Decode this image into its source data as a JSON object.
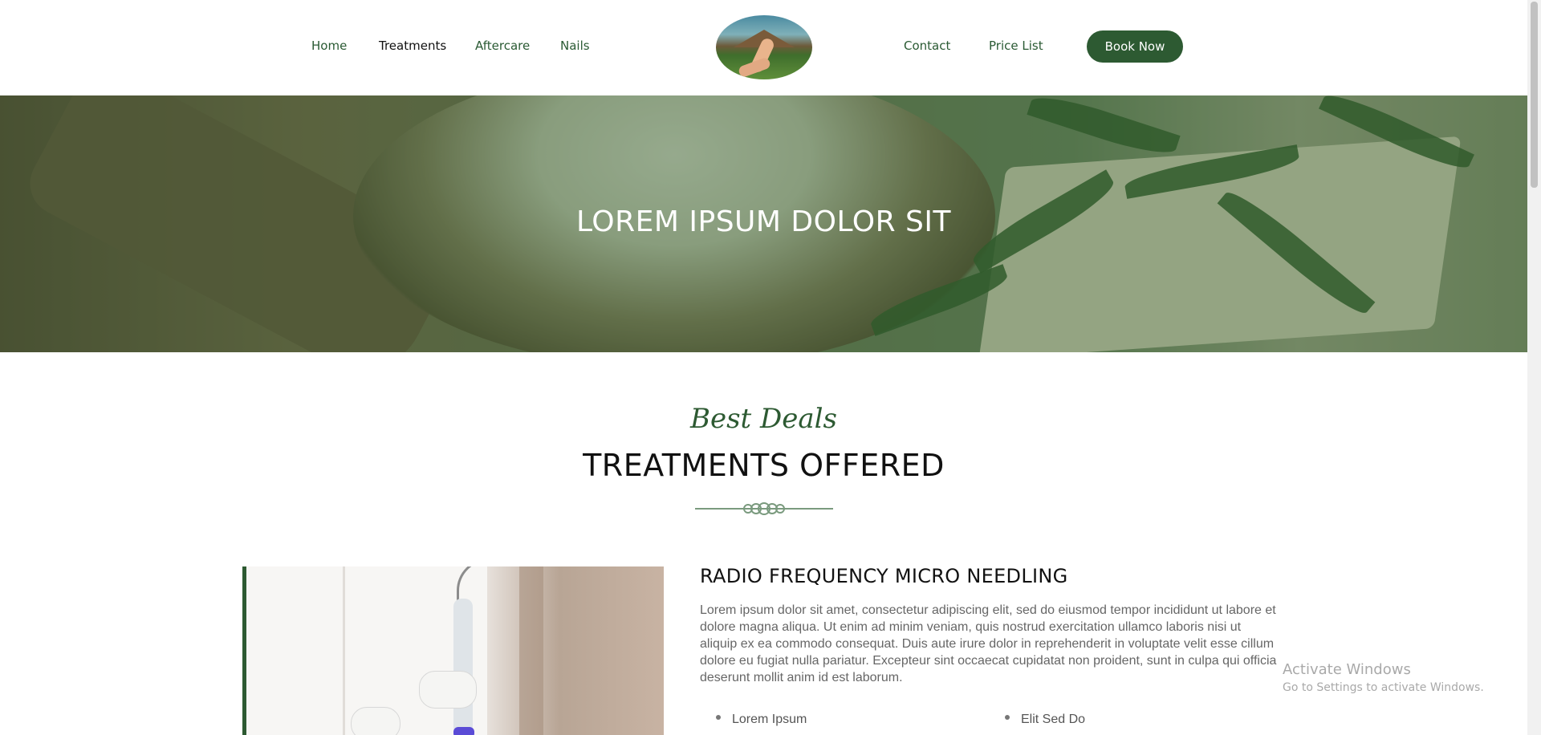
{
  "nav": {
    "items": [
      {
        "label": "Home",
        "active": false
      },
      {
        "label": "Treatments",
        "active": true
      },
      {
        "label": "Aftercare",
        "active": false
      },
      {
        "label": "Nails",
        "active": false
      },
      {
        "label": "Contact",
        "active": false
      },
      {
        "label": "Price List",
        "active": false
      }
    ],
    "book_label": "Book Now",
    "logo_icon": "logo-hand-hut-image"
  },
  "hero": {
    "title": "LOREM IPSUM DOLOR SIT"
  },
  "section": {
    "script_title": "Best Deals",
    "title": "TREATMENTS OFFERED",
    "divider_icon": "ornament-divider-icon"
  },
  "treatment": {
    "title": "RADIO FREQUENCY MICRO NEEDLING",
    "description": "Lorem ipsum dolor sit amet, consectetur adipiscing elit, sed do eiusmod tempor incididunt ut labore et dolore magna aliqua. Ut enim ad minim veniam, quis nostrud exercitation ullamco laboris nisi ut aliquip ex ea commodo consequat. Duis aute irure dolor in reprehenderit in voluptate velit esse cillum dolore eu fugiat nulla pariatur. Excepteur sint occaecat cupidatat non proident, sunt in culpa qui officia deserunt mollit anim id est laborum.",
    "bullets": [
      "Lorem Ipsum",
      "Elit Sed Do"
    ]
  },
  "watermark": {
    "line1": "Activate Windows",
    "line2": "Go to Settings to activate Windows."
  },
  "colors": {
    "brand_green": "#2d5a32",
    "nav_text": "#2a5a33",
    "body_text": "#666666"
  }
}
